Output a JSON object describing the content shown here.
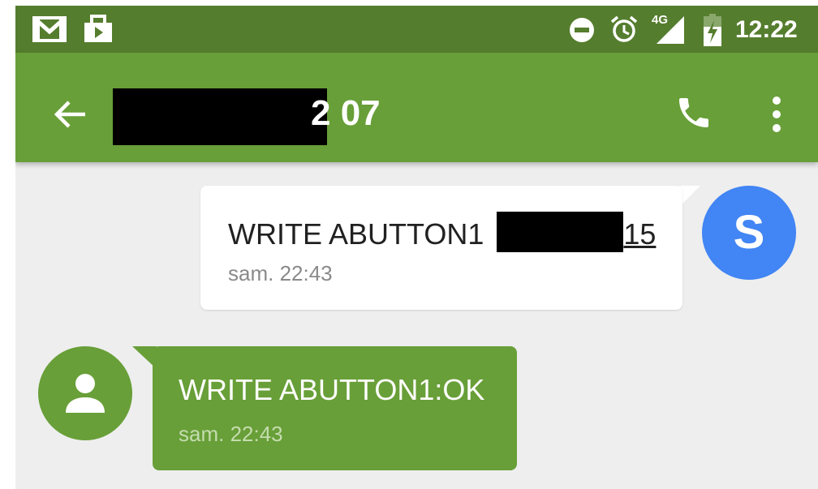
{
  "status_bar": {
    "time": "12:22",
    "network_label": "4G",
    "icons": [
      "gmail-icon",
      "shopping-bag-icon",
      "do-not-disturb-icon",
      "alarm-icon",
      "signal-4g-icon",
      "battery-charging-icon"
    ]
  },
  "app_bar": {
    "title_visible_suffix": "2 07",
    "icons": [
      "back-arrow-icon",
      "phone-icon",
      "more-vert-icon"
    ]
  },
  "messages": [
    {
      "direction": "outgoing",
      "text_prefix": "WRITE ABUTTON1",
      "text_suffix": "15",
      "time": "sam. 22:43",
      "avatar_letter": "S"
    },
    {
      "direction": "incoming",
      "text": "WRITE ABUTTON1:OK",
      "time": "sam. 22:43",
      "avatar_icon": "person-icon"
    }
  ],
  "colors": {
    "status_bar": "#557d2e",
    "app_bar": "#689f38",
    "incoming_bubble": "#689f38",
    "outgoing_bubble": "#ffffff",
    "sender_avatar": "#4285f4",
    "background": "#eeeeee"
  }
}
